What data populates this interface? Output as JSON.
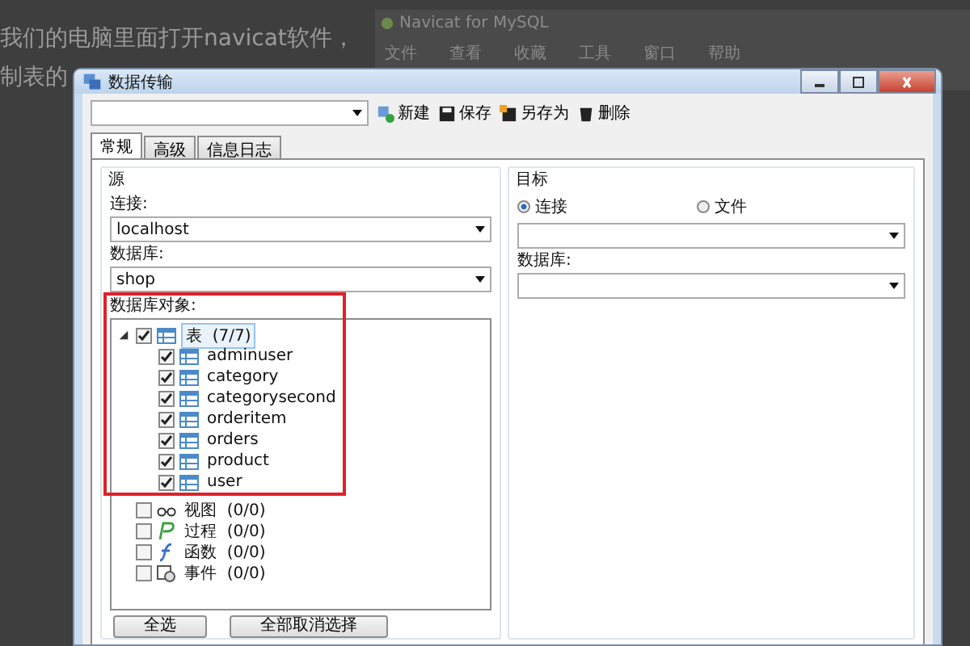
{
  "background": {
    "article_lines": [
      "我们的电脑里面打开navicat软件，",
      "制表的"
    ],
    "app_title": "Navicat for MySQL",
    "app_menu": [
      "文件",
      "查看",
      "收藏",
      "工具",
      "窗口",
      "帮助"
    ]
  },
  "window": {
    "title": "数据传输"
  },
  "toolbar": {
    "buttons": [
      {
        "label": "新建",
        "kind": "new"
      },
      {
        "label": "保存",
        "kind": "save"
      },
      {
        "label": "另存为",
        "kind": "saveas"
      },
      {
        "label": "删除",
        "kind": "delete"
      }
    ]
  },
  "tabs": [
    {
      "label": "常规",
      "selected": true
    },
    {
      "label": "高级",
      "selected": false
    },
    {
      "label": "信息日志",
      "selected": false
    }
  ],
  "source": {
    "title": "源",
    "connection_label": "连接:",
    "connection": "localhost",
    "database_label": "数据库:",
    "database": "shop",
    "objects_label": "数据库对象:",
    "tree": [
      {
        "label": "表",
        "count": "(7/7)",
        "kind": "table",
        "checked": true,
        "expanded": true,
        "selected": true,
        "children": [
          {
            "label": "adminuser",
            "kind": "table",
            "checked": true,
            "selected": false
          },
          {
            "label": "category",
            "kind": "table",
            "checked": true,
            "selected": false
          },
          {
            "label": "categorysecond",
            "kind": "table",
            "checked": true,
            "selected": false
          },
          {
            "label": "orderitem",
            "kind": "table",
            "checked": true,
            "selected": false
          },
          {
            "label": "orders",
            "kind": "table",
            "checked": true,
            "selected": false
          },
          {
            "label": "product",
            "kind": "table",
            "checked": true,
            "selected": false
          },
          {
            "label": "user",
            "kind": "table",
            "checked": true,
            "selected": false
          }
        ]
      },
      {
        "label": "视图",
        "count": "(0/0)",
        "kind": "view",
        "checked": false,
        "expanded": false,
        "selected": false
      },
      {
        "label": "过程",
        "count": "(0/0)",
        "kind": "procedure",
        "checked": false,
        "expanded": false,
        "selected": false
      },
      {
        "label": "函数",
        "count": "(0/0)",
        "kind": "function",
        "checked": false,
        "expanded": false,
        "selected": false
      },
      {
        "label": "事件",
        "count": "(0/0)",
        "kind": "event",
        "checked": false,
        "expanded": false,
        "selected": false
      }
    ],
    "buttons": [
      "全选",
      "全部取消选择"
    ]
  },
  "target": {
    "title": "目标",
    "modes": [
      {
        "label": "连接",
        "selected": true
      },
      {
        "label": "文件",
        "selected": false
      }
    ],
    "database_label": "数据库:"
  }
}
